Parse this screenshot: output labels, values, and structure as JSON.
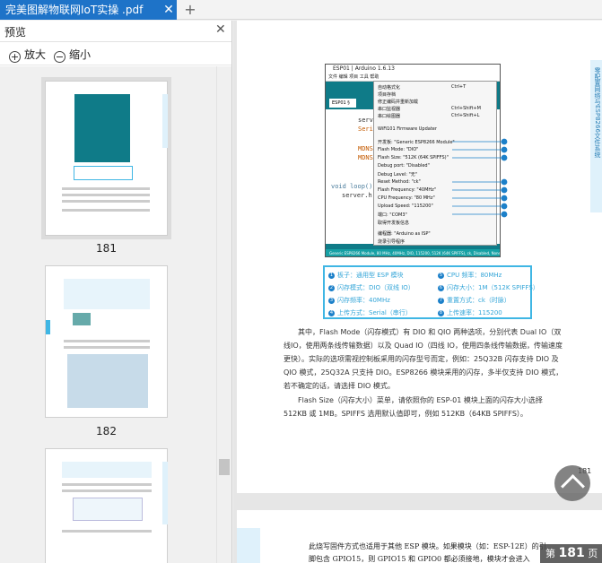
{
  "tab": {
    "title": "完美图解物联网IoT实操 .pdf",
    "close": "✕",
    "add": "+"
  },
  "panel": {
    "title": "预览",
    "close": "✕",
    "zoom_in": "放大",
    "zoom_out": "缩小"
  },
  "thumbnails": [
    {
      "page": "181",
      "selected": true
    },
    {
      "page": "182",
      "selected": false
    },
    {
      "page": "",
      "selected": false
    }
  ],
  "doc": {
    "side_strip": "零配置网络与ESP8266文件系统",
    "arduino": {
      "title": "ESP01 | Arduino 1.6.13",
      "menu": "文件  编辑  项目  工具  帮助",
      "tab": "ESP01 §",
      "code": [
        "server.b",
        "Serial.p",
        "MDNS.ad",
        "MDNS.ad",
        "void loop()",
        "server.h"
      ],
      "status": "Generic ESP8266 Module, 80 MHz, 40MHz, DIO, 115200, 512K (64K SPIFFS), ck, Disabled, None on COM3",
      "popup": [
        {
          "label": "自动格式化",
          "shortcut": "Ctrl+T"
        },
        {
          "label": "项目存档",
          "shortcut": ""
        },
        {
          "label": "修正编码并重新加载",
          "shortcut": ""
        },
        {
          "label": "串口监视器",
          "shortcut": "Ctrl+Shift+M"
        },
        {
          "label": "串口绘图器",
          "shortcut": "Ctrl+Shift+L"
        },
        {
          "label": "WiFi101 Firmware Updater",
          "shortcut": ""
        },
        {
          "label": "开发板: \"Generic ESP8266 Module\"",
          "shortcut": ""
        },
        {
          "label": "Flash Mode: \"DIO\"",
          "shortcut": ""
        },
        {
          "label": "Flash Size: \"512K (64K SPIFFS)\"",
          "shortcut": ""
        },
        {
          "label": "Debug port: \"Disabled\"",
          "shortcut": ""
        },
        {
          "label": "Debug Level: \"无\"",
          "shortcut": ""
        },
        {
          "label": "Reset Method: \"ck\"",
          "shortcut": ""
        },
        {
          "label": "Flash Frequency: \"40MHz\"",
          "shortcut": ""
        },
        {
          "label": "CPU Frequency: \"80 MHz\"",
          "shortcut": ""
        },
        {
          "label": "Upload Speed: \"115200\"",
          "shortcut": ""
        },
        {
          "label": "端口: \"COM3\"",
          "shortcut": ""
        },
        {
          "label": "取得开发板信息",
          "shortcut": ""
        },
        {
          "label": "编程器: \"Arduino as ISP\"",
          "shortcut": ""
        },
        {
          "label": "烧录引导程序",
          "shortcut": ""
        }
      ]
    },
    "legend": [
      {
        "n": "1",
        "text": "板子：通用型 ESP 模块"
      },
      {
        "n": "2",
        "text": "闪存模式：DIO（双线 IO）"
      },
      {
        "n": "3",
        "text": "闪存频率：40MHz"
      },
      {
        "n": "4",
        "text": "上传方式：Serial（串行）"
      },
      {
        "n": "5",
        "text": "CPU 频率：80MHz"
      },
      {
        "n": "6",
        "text": "闪存大小：1M（512K SPIFFS）"
      },
      {
        "n": "7",
        "text": "重置方式：ck（时脉）"
      },
      {
        "n": "8",
        "text": "上传速率：115200"
      }
    ],
    "para1": "其中，Flash Mode（闪存模式）有 DIO 和 QIO 两种选项，分别代表 Dual IO（双线IO，使用两条线传输数据）以及 Quad IO（四线 IO，使用四条线传输数据，传输速度更快）。实际的选项需视控制板采用的闪存型号而定，例如：25Q32B 闪存支持 DIO 及 QIO 模式，25Q32A 只支持 DIO。ESP8266 模块采用的闪存，多半仅支持 DIO 模式，若不确定的话，请选择 DIO 模式。",
    "para2": "Flash Size（闪存大小）菜单，请依照你的 ESP-01 模块上面的闪存大小选择 512KB 或 1MB。SPIFFS 选用默认值即可，例如 512KB（64KB SPIFFS）。",
    "page_number": "181",
    "next_page_text": "此烧写固件方式也适用于其他 ESP 模块。如果模块（如：ESP-12E）的引脚包含 GPIO15，则 GPIO15 和 GPIO0 都必须接地，模块才会进入"
  },
  "page_indicator": {
    "prefix": "第",
    "page": "181",
    "suffix": "页"
  }
}
